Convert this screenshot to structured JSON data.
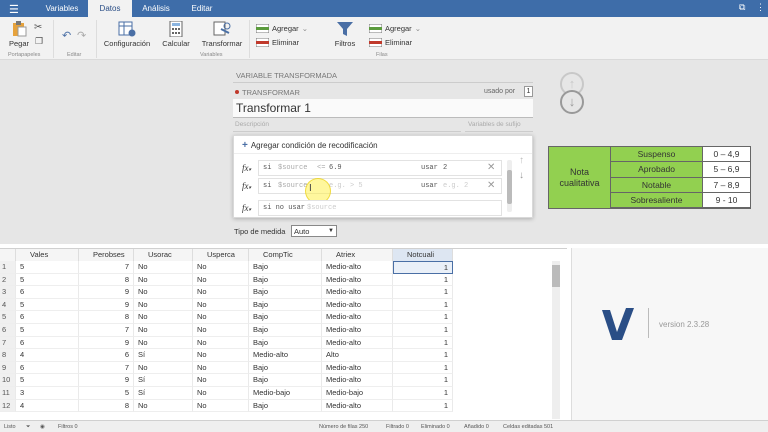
{
  "topbar": {
    "tabs": [
      "Variables",
      "Datos",
      "Análisis",
      "Editar"
    ]
  },
  "ribbon": {
    "pegar": "Pegar",
    "portapapeles": "Portapapeles",
    "editar": "Editar",
    "configuracion": "Configuración",
    "calcular": "Calcular",
    "transformar": "Transformar",
    "variables_group": "Variables",
    "agregar1": "Agregar",
    "eliminar1": "Eliminar",
    "filtros": "Filtros",
    "agregar2": "Agregar",
    "eliminar2": "Eliminar",
    "filas_group": "Filas"
  },
  "transform": {
    "section_title": "VARIABLE TRANSFORMADA",
    "badge": "TRANSFORMAR",
    "used_by_label": "usado por",
    "used_by_count": "1",
    "name": "Transformar 1",
    "desc_placeholder": "Descripción",
    "suffix_placeholder": "Variables de sufijo",
    "add_condition": "Agregar condición de recodificación",
    "conditions": [
      {
        "fx": "fx",
        "if": "si",
        "source": "$source",
        "op": "<=",
        "value": "6.9",
        "use": "usar",
        "result": "2"
      },
      {
        "fx": "fx",
        "if": "si",
        "source": "$source",
        "op": "",
        "value": "e.g. > 5",
        "use": "usar",
        "result": "e.g. 2"
      }
    ],
    "else_line": {
      "fx": "fx",
      "text": "si no usar",
      "value": "$source"
    },
    "measure_label": "Tipo de medida",
    "measure_value": "Auto"
  },
  "grade_table": {
    "title": "Nota cualitativa",
    "rows": [
      [
        "Suspenso",
        "0 – 4,9"
      ],
      [
        "Aprobado",
        "5 – 6,9"
      ],
      [
        "Notable",
        "7 – 8,9"
      ],
      [
        "Sobresaliente",
        "9 - 10"
      ]
    ]
  },
  "grid": {
    "headers": [
      "Vales",
      "Perobses",
      "Usorac",
      "Usperca",
      "CompTic",
      "Atriex",
      "Notcuali"
    ],
    "rows": [
      [
        "1",
        "5",
        "7",
        "No",
        "No",
        "Bajo",
        "Medio-alto",
        "1"
      ],
      [
        "2",
        "5",
        "8",
        "No",
        "No",
        "Bajo",
        "Medio-alto",
        "1"
      ],
      [
        "3",
        "6",
        "9",
        "No",
        "No",
        "Bajo",
        "Medio-alto",
        "1"
      ],
      [
        "4",
        "5",
        "9",
        "No",
        "No",
        "Bajo",
        "Medio-alto",
        "1"
      ],
      [
        "5",
        "6",
        "8",
        "No",
        "No",
        "Bajo",
        "Medio-alto",
        "1"
      ],
      [
        "6",
        "5",
        "7",
        "No",
        "No",
        "Bajo",
        "Medio-alto",
        "1"
      ],
      [
        "7",
        "6",
        "9",
        "No",
        "No",
        "Bajo",
        "Medio-alto",
        "1"
      ],
      [
        "8",
        "4",
        "6",
        "Sí",
        "No",
        "Medio-alto",
        "Alto",
        "1"
      ],
      [
        "9",
        "6",
        "7",
        "No",
        "No",
        "Bajo",
        "Medio-alto",
        "1"
      ],
      [
        "10",
        "5",
        "9",
        "Sí",
        "No",
        "Bajo",
        "Medio-alto",
        "1"
      ],
      [
        "11",
        "3",
        "5",
        "Sí",
        "No",
        "Medio-bajo",
        "Medio-bajo",
        "1"
      ],
      [
        "12",
        "4",
        "8",
        "No",
        "No",
        "Bajo",
        "Medio-alto",
        "1"
      ]
    ]
  },
  "brand": {
    "version": "version 2.3.28"
  },
  "status": {
    "ready": "Listo",
    "filters": "Filtros 0",
    "rows": "Número de filas 250",
    "filtered": "Filtrado 0",
    "deleted": "Eliminado 0",
    "added": "Añadido 0",
    "edited": "Celdas editadas 501"
  }
}
